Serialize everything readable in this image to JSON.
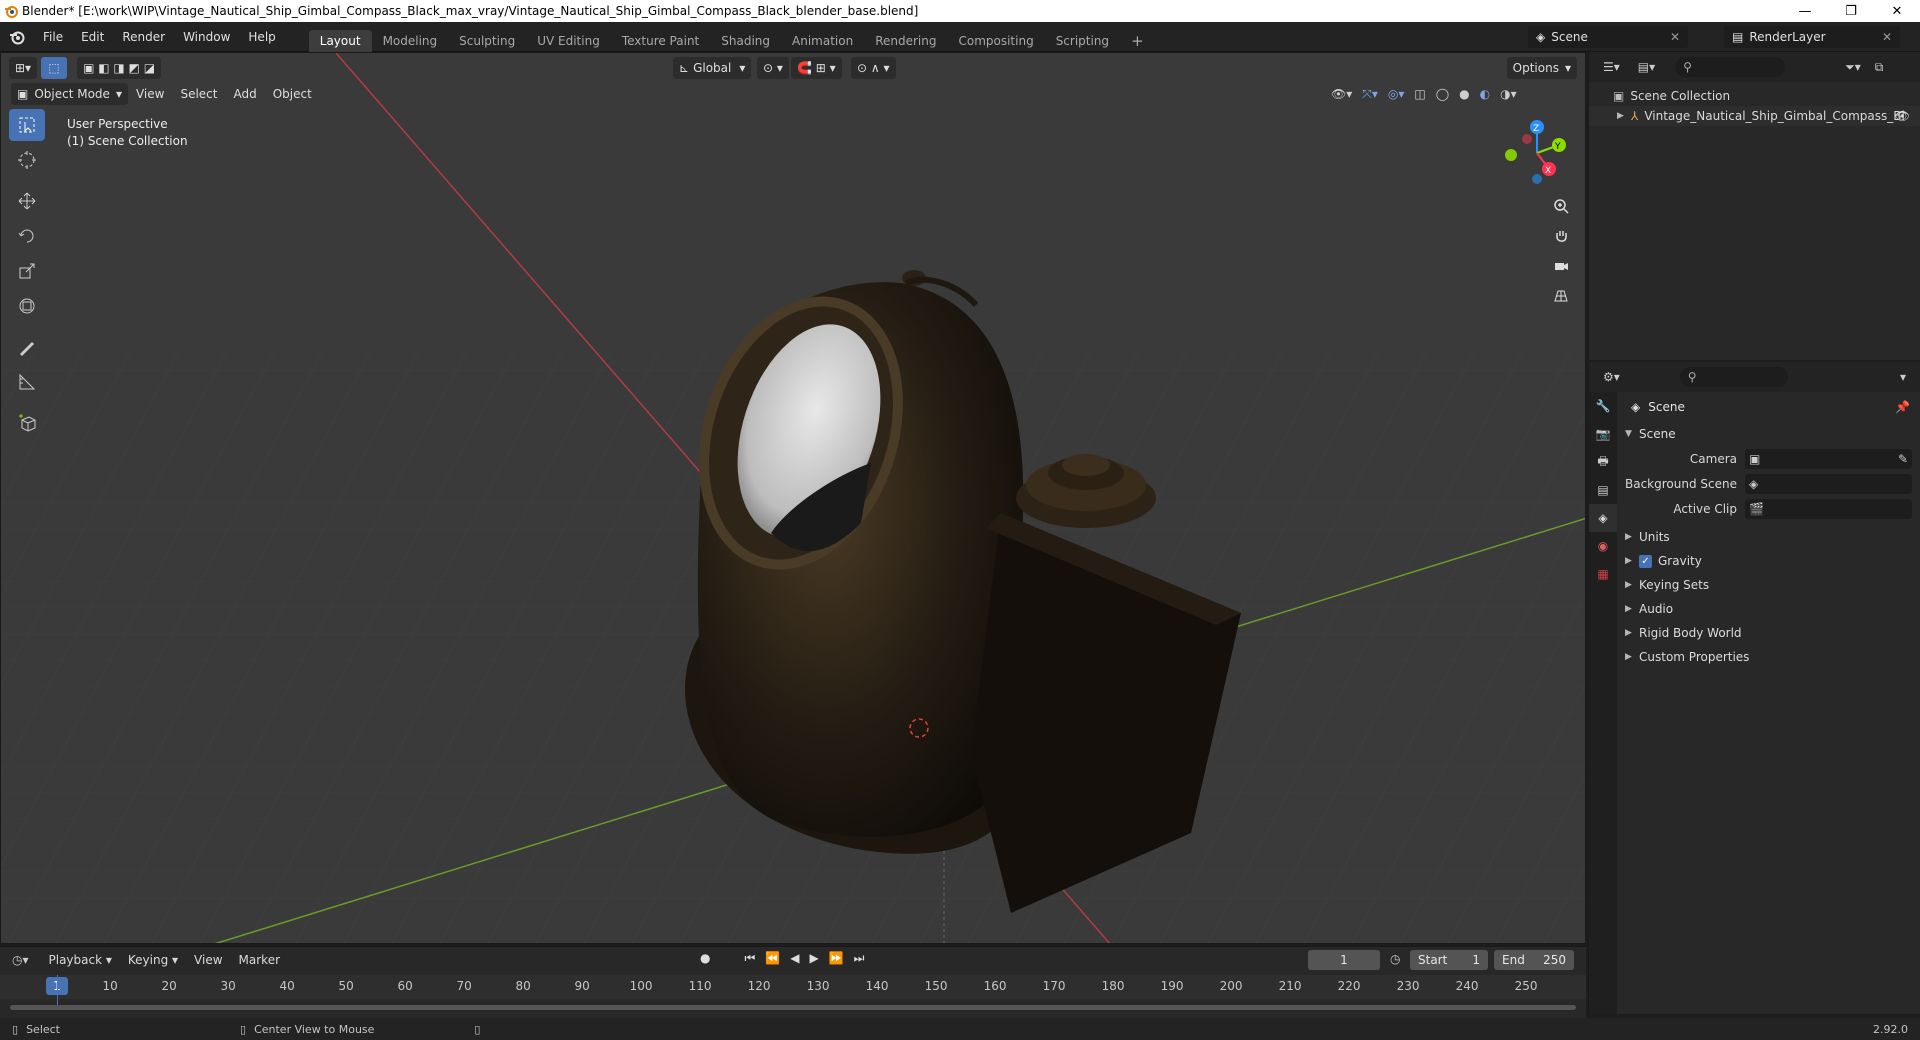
{
  "window": {
    "title": "Blender* [E:\\work\\WIP\\Vintage_Nautical_Ship_Gimbal_Compass_Black_max_vray/Vintage_Nautical_Ship_Gimbal_Compass_Black_blender_base.blend]",
    "minimize": "—",
    "restore": "❐",
    "close": "✕"
  },
  "menu": {
    "items": [
      "File",
      "Edit",
      "Render",
      "Window",
      "Help"
    ]
  },
  "workspaces": [
    "Layout",
    "Modeling",
    "Sculpting",
    "UV Editing",
    "Texture Paint",
    "Shading",
    "Animation",
    "Rendering",
    "Compositing",
    "Scripting"
  ],
  "workspace_add": "+",
  "scene": {
    "name": "Scene"
  },
  "render_layer": {
    "name": "RenderLayer"
  },
  "viewport": {
    "mode": "Object Mode",
    "menus": [
      "View",
      "Select",
      "Add",
      "Object"
    ],
    "transform_orientation": "Global",
    "options_label": "Options",
    "perspective_label": "User Perspective",
    "collection_label": "(1) Scene Collection",
    "gizmo_axes": [
      "X",
      "Y",
      "Z"
    ]
  },
  "outliner": {
    "root": "Scene Collection",
    "items": [
      {
        "label": "Vintage_Nautical_Ship_Gimbal_Compass_Bl"
      }
    ]
  },
  "properties": {
    "context_title": "Scene",
    "scene_section": "Scene",
    "fields": [
      {
        "label": "Camera",
        "value": ""
      },
      {
        "label": "Background Scene",
        "value": ""
      },
      {
        "label": "Active Clip",
        "value": ""
      }
    ],
    "sections": [
      {
        "label": "Units",
        "checkbox": false
      },
      {
        "label": "Gravity",
        "checkbox": true
      },
      {
        "label": "Keying Sets",
        "checkbox": false
      },
      {
        "label": "Audio",
        "checkbox": false
      },
      {
        "label": "Rigid Body World",
        "checkbox": false
      },
      {
        "label": "Custom Properties",
        "checkbox": false
      }
    ]
  },
  "timeline": {
    "menus": [
      "Playback",
      "Keying",
      "View",
      "Marker"
    ],
    "current_frame": "1",
    "start_label": "Start",
    "start_value": "1",
    "end_label": "End",
    "end_value": "250",
    "ruler_labels": [
      "1",
      "10",
      "20",
      "30",
      "40",
      "50",
      "60",
      "70",
      "80",
      "90",
      "100",
      "110",
      "120",
      "130",
      "140",
      "150",
      "160",
      "170",
      "180",
      "190",
      "200",
      "210",
      "220",
      "230",
      "240",
      "250"
    ]
  },
  "statusbar": {
    "left_action": "Select",
    "middle_action": "Center View to Mouse",
    "version": "2.92.0"
  },
  "colors": {
    "accent": "#4772b3",
    "axis_x": "#ff3352",
    "axis_y": "#8bdc00",
    "axis_z": "#2890ff"
  }
}
